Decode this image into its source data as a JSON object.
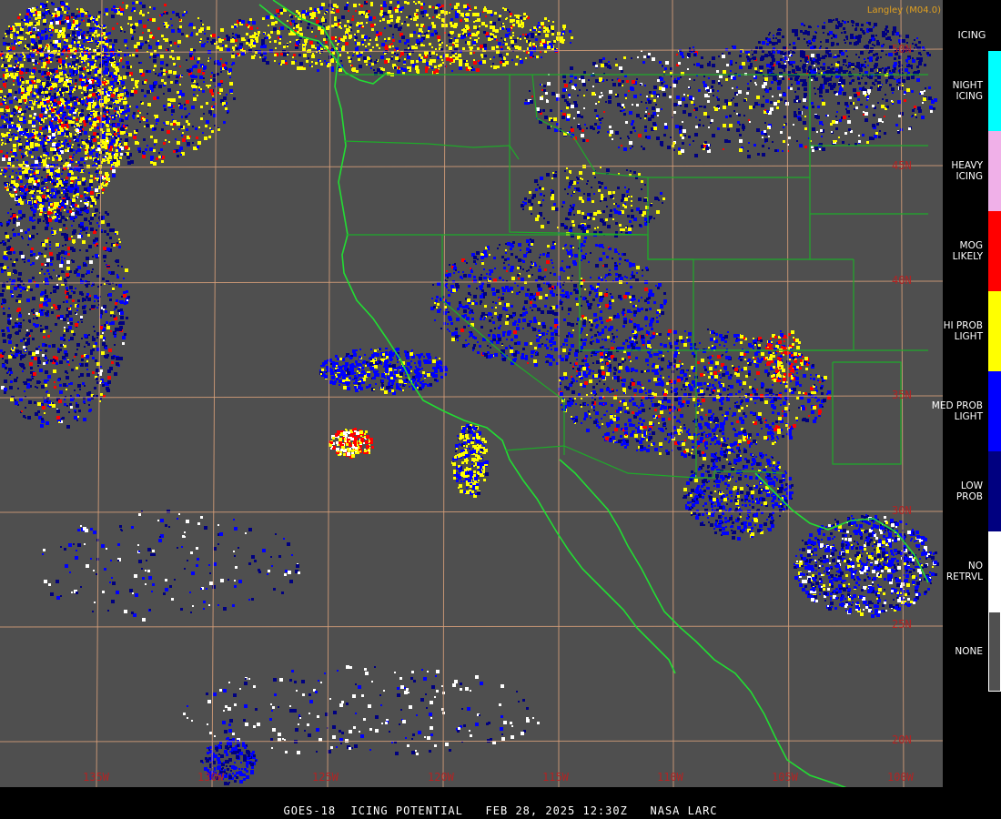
{
  "credit": "Langley (M04.0)",
  "caption": "GOES-18  ICING POTENTIAL   FEB 28, 2025 12:30Z   NASA LARC",
  "legend": {
    "title": "ICING",
    "items": [
      {
        "label": "NIGHT ICING",
        "color": "#00ffff"
      },
      {
        "label": "HEAVY ICING",
        "color": "#f0b0e8"
      },
      {
        "label": "MOG LIKELY",
        "color": "#ff0000"
      },
      {
        "label": "HI PROB LIGHT",
        "color": "#ffff00"
      },
      {
        "label": "MED PROB LIGHT",
        "color": "#0000ff"
      },
      {
        "label": "LOW PROB",
        "color": "#000080"
      },
      {
        "label": "NO RETRVL",
        "color": "#ffffff"
      },
      {
        "label": "NONE",
        "color": "#505050"
      }
    ]
  },
  "grid": {
    "lat_labels": [
      "50N",
      "45N",
      "40N",
      "35N",
      "30N",
      "25N",
      "20N"
    ],
    "lon_labels": [
      "135W",
      "130W",
      "125W",
      "120W",
      "115W",
      "110W",
      "105W",
      "100W"
    ]
  }
}
